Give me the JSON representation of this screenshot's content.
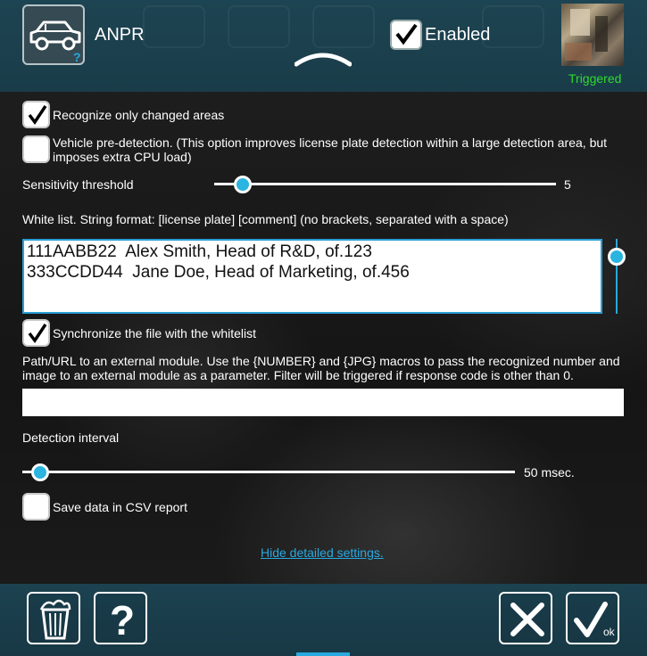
{
  "header": {
    "title": "ANPR",
    "enabled_label": "Enabled",
    "enabled_checked": true,
    "status": "Triggered",
    "status_color": "#2fd92f"
  },
  "settings": {
    "recognize_changed_label": "Recognize only changed areas",
    "recognize_changed_checked": true,
    "vehicle_predetection_label": "Vehicle pre-detection. (This option improves license plate detection within a large detection area, but imposes extra CPU load)",
    "vehicle_predetection_checked": false,
    "sensitivity_label": "Sensitivity threshold",
    "sensitivity_value": "5",
    "whitelist_label": "White list. String format: [license plate] [comment] (no brackets, separated with a space)",
    "whitelist_text": "111AABB22  Alex Smith, Head of R&D, of.123\n333CCDD44  Jane Doe, Head of Marketing, of.456",
    "sync_label": "Synchronize the file with the whitelist",
    "sync_checked": true,
    "path_label": "Path/URL to an external module. Use the {NUMBER} and {JPG} macros to pass the recognized number and image to an external module as a parameter. Filter will be triggered if response code is other than 0.",
    "path_value": "",
    "interval_label": "Detection interval",
    "interval_value": "50 msec.",
    "csv_label": "Save data in CSV report",
    "csv_checked": false,
    "hide_link": "Hide detailed settings."
  },
  "footer": {
    "delete_icon": "trash-icon",
    "help_icon": "question-icon",
    "cancel_icon": "close-icon",
    "ok_icon": "check-ok-icon",
    "ok_sub": "ok"
  },
  "colors": {
    "accent": "#2aa9e0",
    "header_bg": "#1d4452"
  }
}
